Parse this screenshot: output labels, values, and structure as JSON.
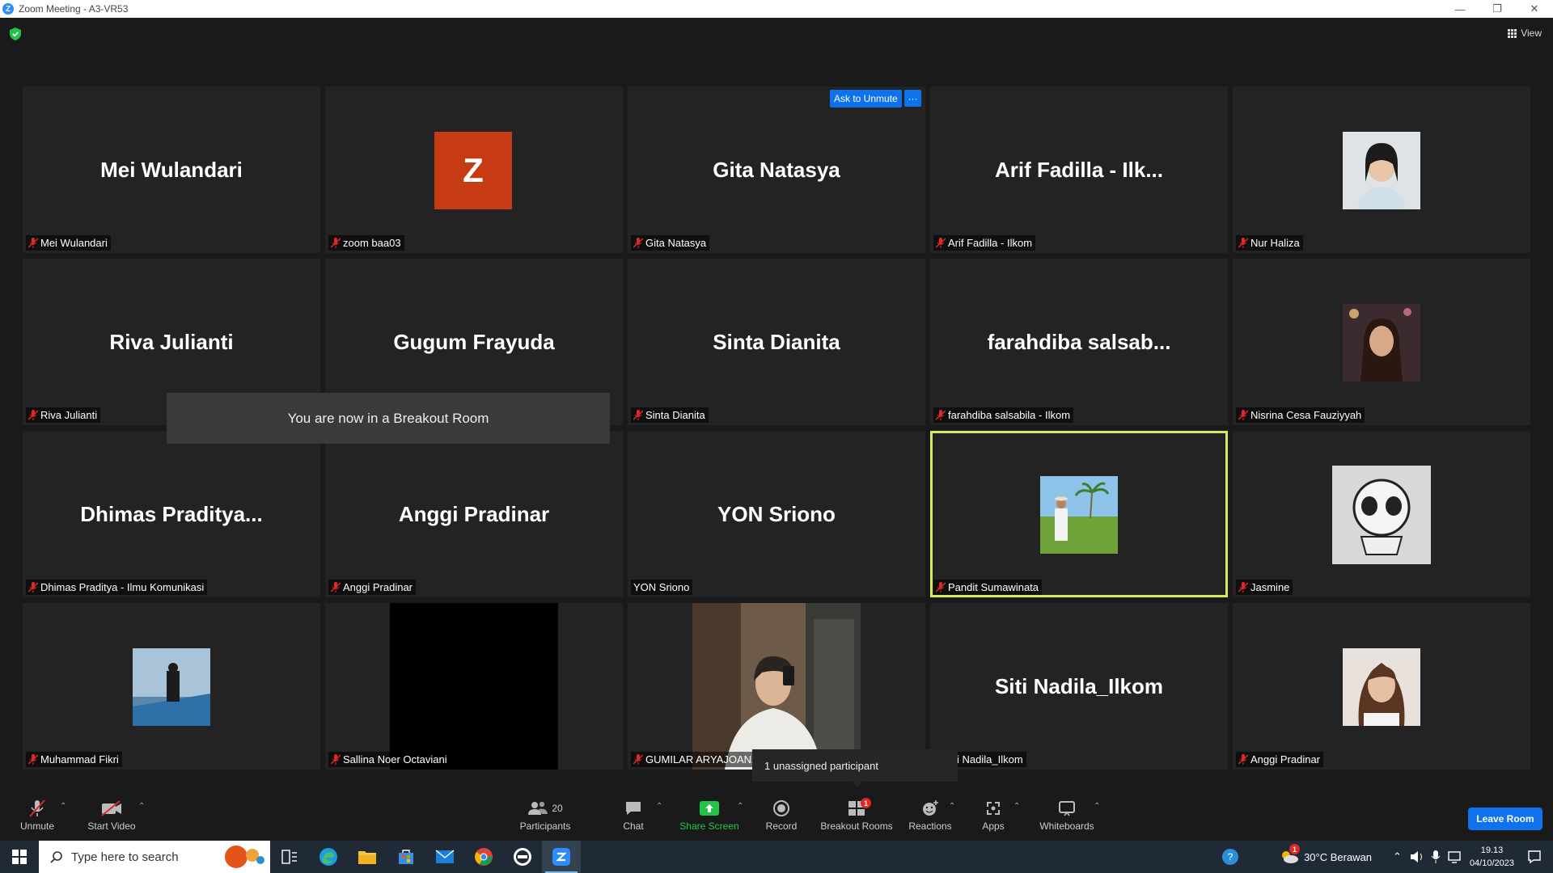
{
  "window": {
    "title": "Zoom Meeting - A3-VR53"
  },
  "header": {
    "view_label": "View"
  },
  "tiles": [
    {
      "big": "Mei Wulandari",
      "label": "Mei Wulandari",
      "muted": true
    },
    {
      "big": "",
      "label": "zoom baa03",
      "muted": true,
      "avatar_letter": "Z"
    },
    {
      "big": "Gita Natasya",
      "label": "Gita Natasya",
      "muted": true
    },
    {
      "big": "Arif Fadilla - Ilk...",
      "label": "Arif Fadilla - Ilkom",
      "muted": true
    },
    {
      "big": "",
      "label": "Nur Haliza",
      "muted": true
    },
    {
      "big": "Riva Julianti",
      "label": "Riva Julianti",
      "muted": true
    },
    {
      "big": "Gugum Frayuda",
      "label": "",
      "muted": false
    },
    {
      "big": "Sinta Dianita",
      "label": "Sinta Dianita",
      "muted": true
    },
    {
      "big": "farahdiba  salsab...",
      "label": "farahdiba salsabila - Ilkom",
      "muted": true
    },
    {
      "big": "",
      "label": "Nisrina Cesa Fauziyyah",
      "muted": true
    },
    {
      "big": "Dhimas  Praditya...",
      "label": "Dhimas Praditya - Ilmu Komunikasi",
      "muted": true
    },
    {
      "big": "Anggi Pradinar",
      "label": "Anggi Pradinar",
      "muted": true
    },
    {
      "big": "YON Sriono",
      "label": "YON Sriono",
      "muted": false
    },
    {
      "big": "",
      "label": "Pandit Sumawinata",
      "muted": true
    },
    {
      "big": "",
      "label": "Jasmine",
      "muted": true
    },
    {
      "big": "",
      "label": "Muhammad Fikri",
      "muted": true
    },
    {
      "big": "",
      "label": "Sallina Noer Octaviani",
      "muted": true
    },
    {
      "big": "",
      "label": "GUMILAR ARYAJOANZA",
      "muted": true
    },
    {
      "big": "Siti Nadila_Ilkom",
      "label": "i Nadila_Ilkom",
      "muted": false
    },
    {
      "big": "",
      "label": "Anggi Pradinar",
      "muted": true
    }
  ],
  "overlays": {
    "ask_to_unmute": "Ask to Unmute",
    "more": "···",
    "breakout_toast": "You are now in a Breakout Room",
    "unassigned_tooltip": "1 unassigned participant"
  },
  "toolbar": {
    "unmute": "Unmute",
    "start_video": "Start Video",
    "participants": "Participants",
    "participants_count": "20",
    "chat": "Chat",
    "share_screen": "Share Screen",
    "record": "Record",
    "breakout_rooms": "Breakout Rooms",
    "breakout_badge": "1",
    "reactions": "Reactions",
    "apps": "Apps",
    "whiteboards": "Whiteboards",
    "leave_room": "Leave Room"
  },
  "taskbar": {
    "search_placeholder": "Type here to search",
    "weather": "30°C  Berawan",
    "weather_badge": "1",
    "time": "19.13",
    "date": "04/10/2023"
  },
  "colors": {
    "accent": "#0e72ed",
    "share_green": "#23c34a",
    "active_speaker": "#d8ea5a",
    "avatar_z": "#c63b13",
    "muted_red": "#e02828"
  }
}
